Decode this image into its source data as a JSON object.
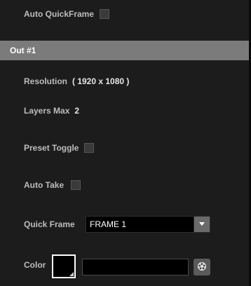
{
  "auto_quickframe": {
    "label": "Auto QuickFrame",
    "checked": false
  },
  "section": {
    "title": "Out #1"
  },
  "resolution": {
    "label": "Resolution",
    "value": "( 1920 x 1080 )"
  },
  "layers_max": {
    "label": "Layers Max",
    "value": "2"
  },
  "preset_toggle": {
    "label": "Preset Toggle",
    "checked": false
  },
  "auto_take": {
    "label": "Auto Take",
    "checked": false
  },
  "quick_frame": {
    "label": "Quick Frame",
    "selected": "FRAME 1"
  },
  "color": {
    "label": "Color",
    "swatch": "#000000",
    "value": ""
  },
  "icons": {
    "dropdown_arrow": "chevron-down-icon",
    "picker": "color-palette-icon"
  },
  "colors": {
    "background": "#1c1c1c",
    "header": "#7b7b7b",
    "label": "#bdbdbd"
  }
}
